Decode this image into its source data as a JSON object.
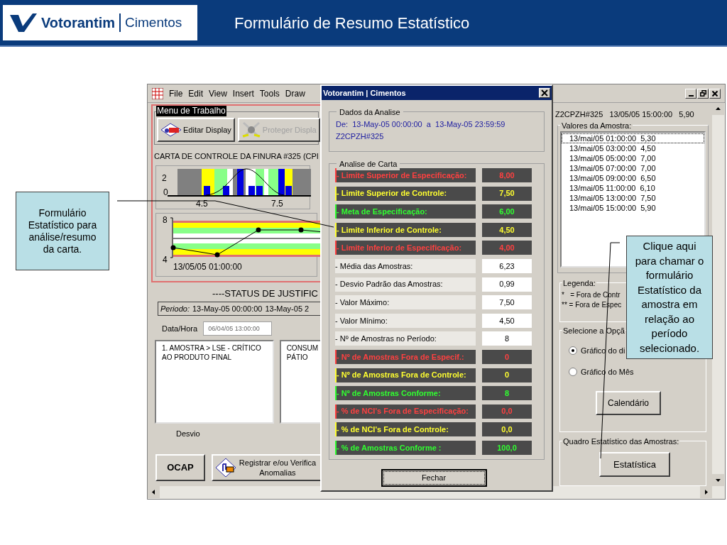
{
  "header": {
    "logo": {
      "brand": "Votorantim",
      "division": "Cimentos"
    },
    "title": "Formulário de Resumo Estatístico"
  },
  "app_window": {
    "menu": [
      "File",
      "Edit",
      "View",
      "Insert",
      "Tools",
      "Draw"
    ],
    "work_menu": {
      "title": "Menu de Trabalho",
      "buttons": [
        {
          "label": "Editar Display",
          "disabled": false
        },
        {
          "label": "Proteger Displa",
          "disabled": true
        }
      ]
    },
    "chart_title": "CARTA DE CONTROLE DA FINURA #325 (CPI",
    "histogram": {
      "y_labels": [
        "2",
        "0"
      ],
      "x_labels": [
        "4.5",
        "7.5"
      ]
    },
    "control_chart": {
      "y_labels": [
        "8",
        "4"
      ],
      "x_label": "13/05/05 01:00:00"
    },
    "status_title": "----STATUS DE JUSTIFIC",
    "period": {
      "label": "Periodo:",
      "start": "13-May-05 00:00:00",
      "end": "13-May-05 2"
    },
    "date_field": {
      "label": "Data/Hora",
      "value": "06/04/05 13:00:00"
    },
    "text_boxes": [
      "1. AMOSTRA > LSE - CRÍTICO AO PRODUTO FINAL",
      "CONSUM PÁTIO"
    ],
    "deviation_label": "Desvio",
    "ocap_button": "OCAP",
    "register_button": [
      "Registrar e/ou Verifica",
      "Anomalias"
    ],
    "current_sample": "Z2CPZH#325   13/05/05 15:00:00   5,90",
    "samples": {
      "title": "Valores da Amostra:",
      "items": [
        {
          "time": "13/mai/05 01:00:00",
          "value": "5,30",
          "selected": true
        },
        {
          "time": "13/mai/05 03:00:00",
          "value": "4,50",
          "selected": false
        },
        {
          "time": "13/mai/05 05:00:00",
          "value": "7,00",
          "selected": false
        },
        {
          "time": "13/mai/05 07:00:00",
          "value": "7,00",
          "selected": false
        },
        {
          "time": "13/mai/05 09:00:00",
          "value": "6,50",
          "selected": false
        },
        {
          "time": "13/mai/05 11:00:00",
          "value": "6,10",
          "selected": false
        },
        {
          "time": "13/mai/05 13:00:00",
          "value": "7,50",
          "selected": false
        },
        {
          "time": "13/mai/05 15:00:00",
          "value": "5,90",
          "selected": false
        }
      ]
    },
    "legend": {
      "title": "Legenda:",
      "items": [
        "*   = Fora de Contr",
        "** = Fora de Espec"
      ]
    },
    "options": {
      "title": "Selecione a Opçã",
      "radios": [
        {
          "label": "Gráfico do di",
          "selected": true
        },
        {
          "label": "Gráfico do Mês",
          "selected": false
        }
      ],
      "button": "Calendário"
    },
    "stats": {
      "title": "Quadro Estatístico das Amostras:",
      "button": "Estatística"
    }
  },
  "dialog": {
    "title": "Votorantim | Cimentos",
    "data": {
      "title": "Dados da Analise",
      "range": "De:  13-May-05 00:00:00  a  13-May-05 23:59:59",
      "tag": "Z2CPZH#325"
    },
    "analysis": {
      "title": "Analise de Carta",
      "rows": [
        {
          "kind": "limit",
          "color": "#ff4040",
          "label": "- Limite Superior de Especificação:",
          "value": "8,00"
        },
        {
          "kind": "limit",
          "color": "#ffff30",
          "label": "- Limite Superior de Controle:",
          "value": "7,50"
        },
        {
          "kind": "limit",
          "color": "#30ff30",
          "label": "- Meta de Especificação:",
          "value": "6,00"
        },
        {
          "kind": "limit",
          "color": "#ffff30",
          "label": "- Limite Inferior de Controle:",
          "value": "4,50"
        },
        {
          "kind": "limit",
          "color": "#ff4040",
          "label": "- Limite Inferior de Especificação:",
          "value": "4,00"
        },
        {
          "kind": "value",
          "label": "- Média das Amostras:",
          "value": "6,23"
        },
        {
          "kind": "value",
          "label": "- Desvio Padrão das Amostras:",
          "value": "0,99"
        },
        {
          "kind": "value",
          "label": "- Valor Máximo:",
          "value": "7,50"
        },
        {
          "kind": "value",
          "label": "- Valor Mínimo:",
          "value": "4,50"
        },
        {
          "kind": "value",
          "label": "- Nº de Amostras no Período:",
          "value": "8"
        },
        {
          "kind": "limit",
          "color": "#ff4040",
          "label": "- Nº de Amostras Fora de Especif.:",
          "value": "0"
        },
        {
          "kind": "limit",
          "color": "#ffff30",
          "label": "- Nº de Amostras Fora de Controle:",
          "value": "0"
        },
        {
          "kind": "limit",
          "color": "#30ff30",
          "label": "- Nº de Amostras Conforme:",
          "value": "8"
        },
        {
          "kind": "limit",
          "color": "#ff4040",
          "label": "- % de NCI's Fora de Especificação:",
          "value": "0,0"
        },
        {
          "kind": "limit",
          "color": "#ffff30",
          "label": "- % de NCI's Fora de Controle:",
          "value": "0,0"
        },
        {
          "kind": "limit",
          "color": "#30ff30",
          "label": "- % de Amostras Conforme :",
          "value": "100,0"
        }
      ]
    },
    "close_button": "Fechar"
  },
  "callouts": [
    "Formulário Estatístico para análise/resumo da carta.",
    "Clique aqui para chamar o formulário Estatístico da amostra em relação ao período selecionado."
  ]
}
